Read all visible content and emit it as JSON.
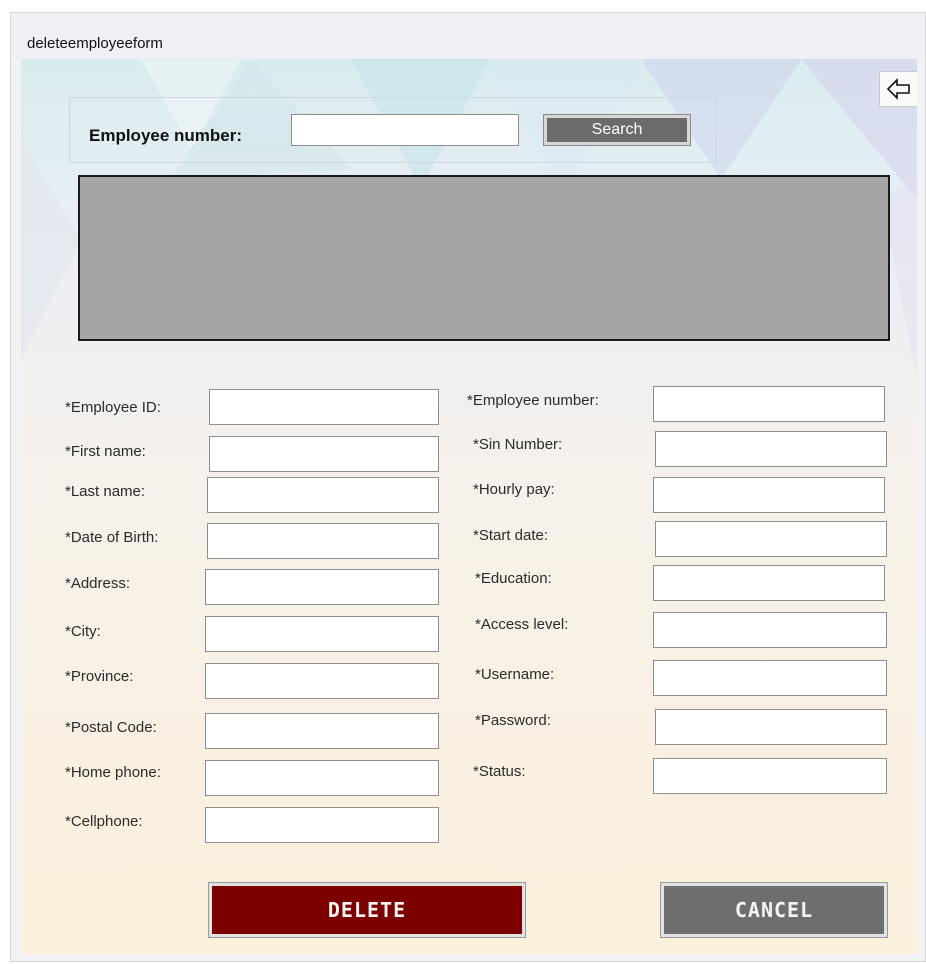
{
  "window": {
    "title": "deleteemployeeform"
  },
  "search": {
    "label": "Employee number:",
    "value": "",
    "button": "Search"
  },
  "icons": {
    "back": "back-arrow-icon"
  },
  "left_fields": [
    {
      "label": "*Employee ID:",
      "value": ""
    },
    {
      "label": "*First name:",
      "value": ""
    },
    {
      "label": "*Last name:",
      "value": ""
    },
    {
      "label": "*Date of Birth:",
      "value": ""
    },
    {
      "label": "*Address:",
      "value": ""
    },
    {
      "label": "*City:",
      "value": ""
    },
    {
      "label": "*Province:",
      "value": ""
    },
    {
      "label": "*Postal Code:",
      "value": ""
    },
    {
      "label": "*Home phone:",
      "value": ""
    },
    {
      "label": "*Cellphone:",
      "value": ""
    }
  ],
  "right_fields": [
    {
      "label": "*Employee number:",
      "value": ""
    },
    {
      "label": "*Sin Number:",
      "value": ""
    },
    {
      "label": "*Hourly pay:",
      "value": ""
    },
    {
      "label": "*Start date:",
      "value": ""
    },
    {
      "label": "*Education:",
      "value": ""
    },
    {
      "label": "*Access level:",
      "value": ""
    },
    {
      "label": "*Username:",
      "value": ""
    },
    {
      "label": "*Password:",
      "value": ""
    },
    {
      "label": "*Status:",
      "value": ""
    }
  ],
  "actions": {
    "delete": "DELETE",
    "cancel": "CANCEL"
  },
  "colors": {
    "delete": "#7d0000",
    "cancel": "#6e6e6e",
    "grid": "#a5a5a5",
    "search_button": "#6b6b6b"
  }
}
